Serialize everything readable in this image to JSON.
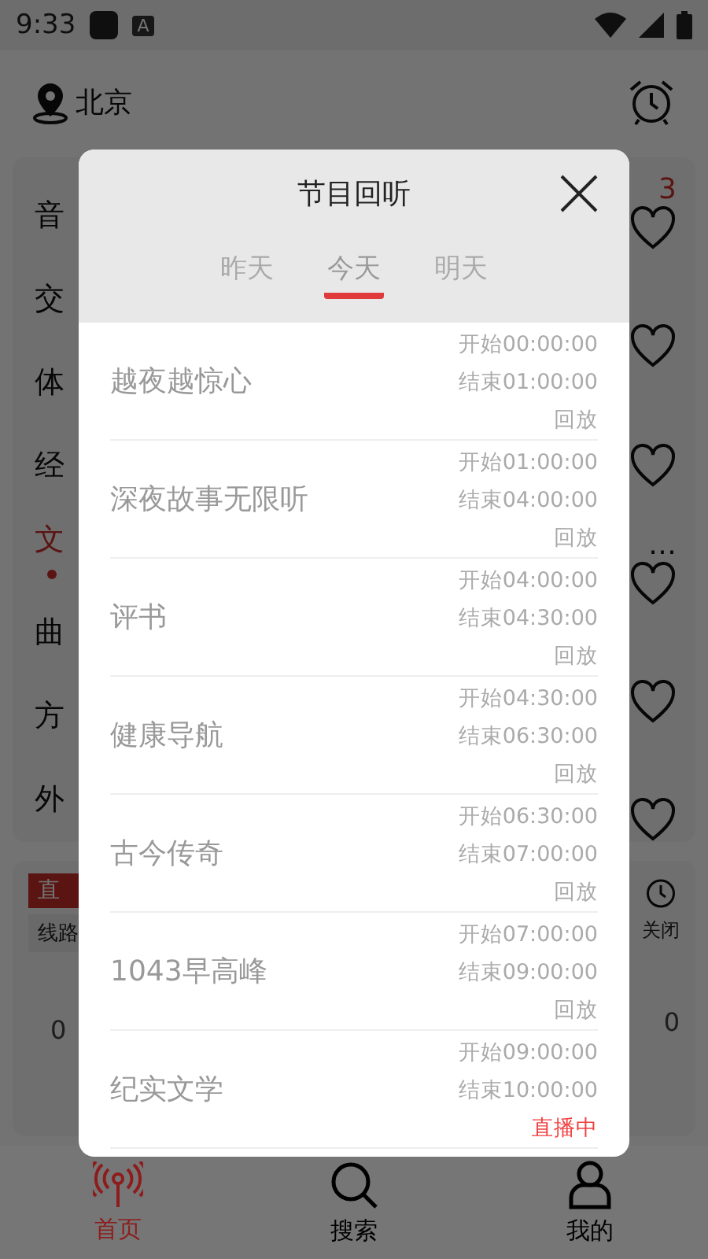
{
  "status_bar": {
    "time": "9:33",
    "notification_letter": "A"
  },
  "header": {
    "city": "北京"
  },
  "categories": [
    {
      "label": "音",
      "selected": false
    },
    {
      "label": "交",
      "selected": false
    },
    {
      "label": "体",
      "selected": false
    },
    {
      "label": "经",
      "selected": false
    },
    {
      "label": "文",
      "selected": true
    },
    {
      "label": "曲",
      "selected": false
    },
    {
      "label": "方",
      "selected": false
    },
    {
      "label": "外",
      "selected": false
    }
  ],
  "side_fragments": [
    "3",
    "…"
  ],
  "player": {
    "badge": "直",
    "line": "线路",
    "left_reading": "0",
    "right_reading": "0",
    "timer_label": "关闭"
  },
  "dialog": {
    "title": "节目回听",
    "tabs": [
      {
        "label": "昨天",
        "selected": false
      },
      {
        "label": "今天",
        "selected": true
      },
      {
        "label": "明天",
        "selected": false
      }
    ],
    "programs": [
      {
        "name": "越夜越惊心",
        "start": "开始00:00:00",
        "end": "结束01:00:00",
        "action": "回放",
        "kind": "replay"
      },
      {
        "name": "深夜故事无限听",
        "start": "开始01:00:00",
        "end": "结束04:00:00",
        "action": "回放",
        "kind": "replay"
      },
      {
        "name": "评书",
        "start": "开始04:00:00",
        "end": "结束04:30:00",
        "action": "回放",
        "kind": "replay"
      },
      {
        "name": "健康导航",
        "start": "开始04:30:00",
        "end": "结束06:30:00",
        "action": "回放",
        "kind": "replay"
      },
      {
        "name": "古今传奇",
        "start": "开始06:30:00",
        "end": "结束07:00:00",
        "action": "回放",
        "kind": "replay"
      },
      {
        "name": "1043早高峰",
        "start": "开始07:00:00",
        "end": "结束09:00:00",
        "action": "回放",
        "kind": "replay"
      },
      {
        "name": "纪实文学",
        "start": "开始09:00:00",
        "end": "结束10:00:00",
        "action": "直播中",
        "kind": "live"
      }
    ]
  },
  "nav": [
    {
      "label": "首页",
      "selected": true,
      "kind": "radio"
    },
    {
      "label": "搜索",
      "selected": false,
      "kind": "search"
    },
    {
      "label": "我的",
      "selected": false,
      "kind": "profile"
    }
  ]
}
